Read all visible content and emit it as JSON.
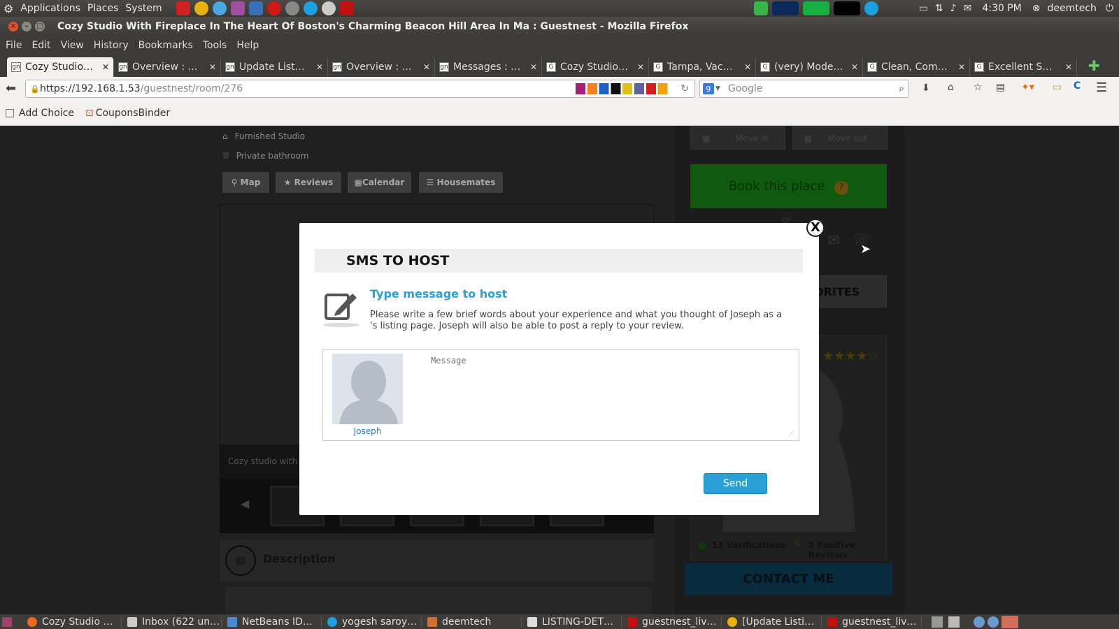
{
  "system_panel": {
    "menus": [
      "Applications",
      "Places",
      "System"
    ],
    "time": "4:30 PM",
    "user": "deemtech"
  },
  "window": {
    "title": "Cozy Studio With Fireplace In The Heart Of Boston's Charming Beacon Hill Area In Ma : Guestnest - Mozilla Firefox"
  },
  "menubar": [
    "File",
    "Edit",
    "View",
    "History",
    "Bookmarks",
    "Tools",
    "Help"
  ],
  "tabs": [
    {
      "label": "Cozy Studio…",
      "active": true
    },
    {
      "label": "Overview : …"
    },
    {
      "label": "Update List…"
    },
    {
      "label": "Overview : …"
    },
    {
      "label": "Messages : …"
    },
    {
      "label": "Cozy Studio…"
    },
    {
      "label": "Tampa, Vac…"
    },
    {
      "label": "(very) Mode…"
    },
    {
      "label": "Clean, Com…"
    },
    {
      "label": "Excellent S…"
    }
  ],
  "nav": {
    "url_host": "https://192.168.1.53",
    "url_path": "/guestnest/room/276",
    "search_placeholder": "Google"
  },
  "bookmarks": [
    "Add Choice",
    "CouponsBinder"
  ],
  "page": {
    "amenities": [
      "Furnished Studio",
      "Private bathroom"
    ],
    "tabs": [
      "Map",
      "Reviews",
      "Calendar",
      "Housemates"
    ],
    "caption": "Cozy studio with fi",
    "description_heading": "Description",
    "move_in": "Move in",
    "move_out": "Move out",
    "book_label": "Book this place",
    "book_help": "?",
    "or_label": "or",
    "favorites_label": "ORITES",
    "verifications": "13 Verifications",
    "positive_reviews": "5 Positive Reviews",
    "contact_label": "CONTACT ME"
  },
  "modal": {
    "title": "SMS TO HOST",
    "subtitle": "Type message to host",
    "instructions": "Please write a few brief words about your experience and what you thought of Joseph as a 's listing page. Joseph will also be able to post a reply to your review.",
    "message_placeholder": "Message",
    "host_name": "Joseph",
    "send_label": "Send",
    "close_symbol": "X"
  },
  "taskbar": [
    "Cozy Studio …",
    "Inbox (622 un…",
    "NetBeans ID…",
    "yogesh saroy…",
    "deemtech",
    "LISTING-DET…",
    "guestnest_liv…",
    "[Update Listi…",
    "guestnest_liv…"
  ],
  "colors": {
    "accent_blue": "#2aa0d6",
    "book_green": "#1d9d1d",
    "contact_blue": "#0f5f8a"
  }
}
